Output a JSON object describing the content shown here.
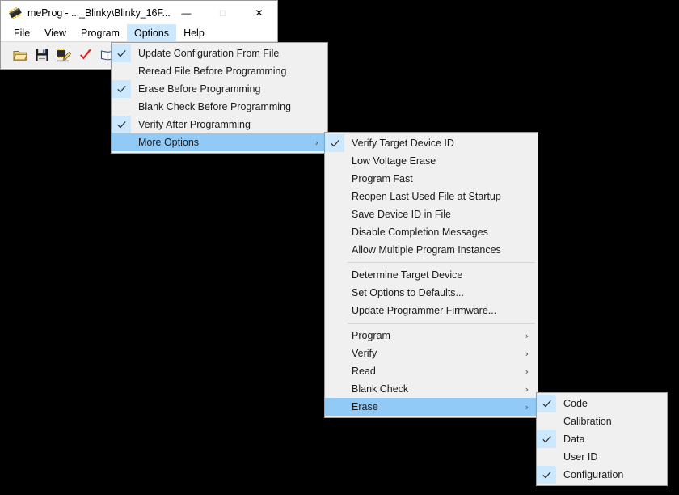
{
  "window": {
    "title": "meProg - ..._Blinky\\Blinky_16F...",
    "icon": "chip-icon",
    "controls": {
      "minimize": "—",
      "maximize": "□",
      "close": "✕",
      "maximize_disabled": true
    }
  },
  "menubar": {
    "items": [
      {
        "label": "File",
        "active": false
      },
      {
        "label": "View",
        "active": false
      },
      {
        "label": "Program",
        "active": false
      },
      {
        "label": "Options",
        "active": true
      },
      {
        "label": "Help",
        "active": false
      }
    ]
  },
  "toolbar": {
    "buttons": [
      {
        "name": "open-file-icon",
        "icon": "open-folder"
      },
      {
        "name": "save-file-icon",
        "icon": "floppy-disk"
      },
      {
        "name": "program-device-icon",
        "icon": "chip-pencil"
      },
      {
        "name": "verify-icon",
        "icon": "red-check"
      },
      {
        "name": "read-device-icon",
        "icon": "blue-book"
      },
      {
        "name": "blank-check-icon",
        "icon": "light-bulb"
      }
    ]
  },
  "menus": {
    "options": {
      "items": [
        {
          "label": "Update Configuration From File",
          "checked": true,
          "submenu": false,
          "highlight": false,
          "separator_after": false
        },
        {
          "label": "Reread File Before Programming",
          "checked": false,
          "submenu": false,
          "highlight": false,
          "separator_after": false
        },
        {
          "label": "Erase Before Programming",
          "checked": true,
          "submenu": false,
          "highlight": false,
          "separator_after": false
        },
        {
          "label": "Blank Check Before Programming",
          "checked": false,
          "submenu": false,
          "highlight": false,
          "separator_after": false
        },
        {
          "label": "Verify After Programming",
          "checked": true,
          "submenu": false,
          "highlight": false,
          "separator_after": false
        },
        {
          "label": "More Options",
          "checked": false,
          "submenu": true,
          "highlight": true,
          "separator_after": false
        }
      ]
    },
    "more_options": {
      "items": [
        {
          "label": "Verify Target Device ID",
          "checked": true,
          "submenu": false,
          "highlight": false,
          "separator_after": false
        },
        {
          "label": "Low Voltage Erase",
          "checked": false,
          "submenu": false,
          "highlight": false,
          "separator_after": false
        },
        {
          "label": "Program Fast",
          "checked": false,
          "submenu": false,
          "highlight": false,
          "separator_after": false
        },
        {
          "label": "Reopen Last Used File at Startup",
          "checked": false,
          "submenu": false,
          "highlight": false,
          "separator_after": false
        },
        {
          "label": "Save Device ID in File",
          "checked": false,
          "submenu": false,
          "highlight": false,
          "separator_after": false
        },
        {
          "label": "Disable Completion Messages",
          "checked": false,
          "submenu": false,
          "highlight": false,
          "separator_after": false
        },
        {
          "label": "Allow Multiple Program Instances",
          "checked": false,
          "submenu": false,
          "highlight": false,
          "separator_after": true
        },
        {
          "label": "Determine Target Device",
          "checked": false,
          "submenu": false,
          "highlight": false,
          "separator_after": false
        },
        {
          "label": "Set Options to Defaults...",
          "checked": false,
          "submenu": false,
          "highlight": false,
          "separator_after": false
        },
        {
          "label": "Update Programmer Firmware...",
          "checked": false,
          "submenu": false,
          "highlight": false,
          "separator_after": true
        },
        {
          "label": "Program",
          "checked": false,
          "submenu": true,
          "highlight": false,
          "separator_after": false
        },
        {
          "label": "Verify",
          "checked": false,
          "submenu": true,
          "highlight": false,
          "separator_after": false
        },
        {
          "label": "Read",
          "checked": false,
          "submenu": true,
          "highlight": false,
          "separator_after": false
        },
        {
          "label": "Blank Check",
          "checked": false,
          "submenu": true,
          "highlight": false,
          "separator_after": false
        },
        {
          "label": "Erase",
          "checked": false,
          "submenu": true,
          "highlight": true,
          "separator_after": false
        }
      ]
    },
    "erase": {
      "items": [
        {
          "label": "Code",
          "checked": true,
          "submenu": false,
          "highlight": false,
          "separator_after": false
        },
        {
          "label": "Calibration",
          "checked": false,
          "submenu": false,
          "highlight": false,
          "separator_after": false
        },
        {
          "label": "Data",
          "checked": true,
          "submenu": false,
          "highlight": false,
          "separator_after": false
        },
        {
          "label": "User ID",
          "checked": false,
          "submenu": false,
          "highlight": false,
          "separator_after": false
        },
        {
          "label": "Configuration",
          "checked": true,
          "submenu": false,
          "highlight": false,
          "separator_after": false
        }
      ]
    }
  },
  "colors": {
    "menu_background": "#f0f0f0",
    "highlight": "#91c9f7",
    "check_background": "#cce8ff",
    "menubar_active": "#cce8ff",
    "window_background": "#ffffff",
    "toolbar_background": "#f0f0f0",
    "desktop": "#000000"
  },
  "icons": {
    "submenu_arrow": "›"
  }
}
